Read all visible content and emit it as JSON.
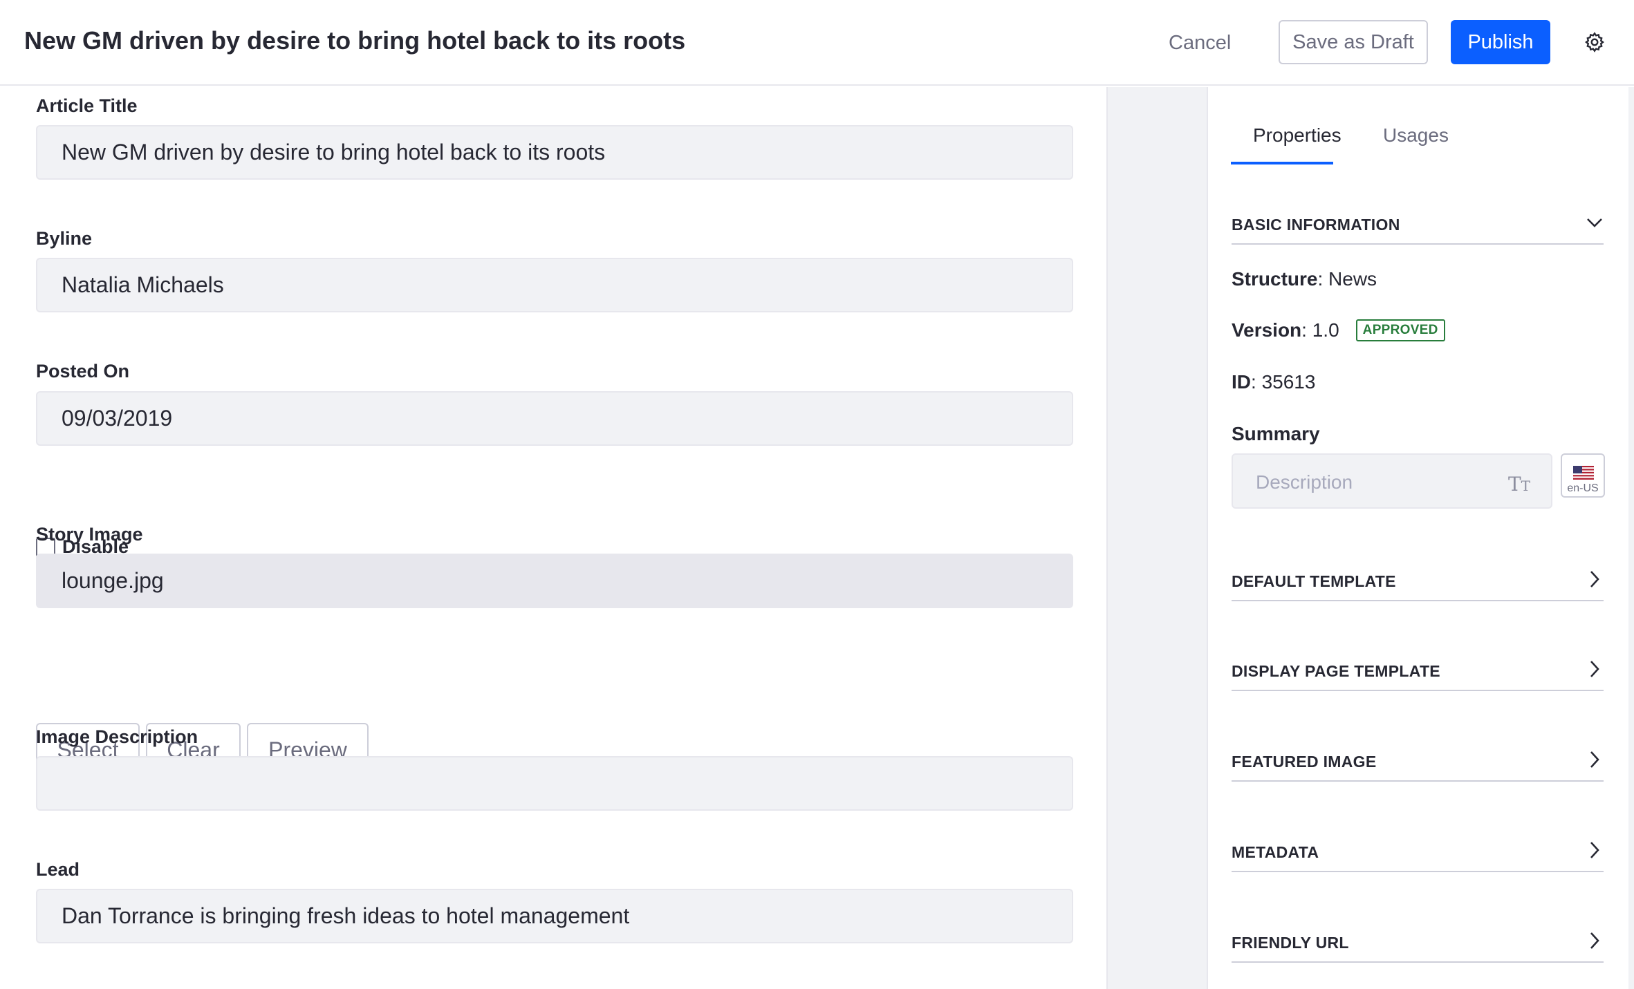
{
  "header": {
    "title": "New GM driven by desire to bring hotel back to its roots",
    "cancel_label": "Cancel",
    "save_draft_label": "Save as Draft",
    "publish_label": "Publish",
    "settings_icon": "gear-icon"
  },
  "form": {
    "article_title": {
      "label": "Article Title",
      "value": "New GM driven by desire to bring hotel back to its roots"
    },
    "byline": {
      "label": "Byline",
      "value": "Natalia Michaels"
    },
    "posted_on": {
      "label": "Posted On",
      "value": "09/03/2019",
      "disable_label": "Disable",
      "disable_checked": false
    },
    "story_image": {
      "label": "Story Image",
      "value": "lounge.jpg",
      "select_label": "Select",
      "clear_label": "Clear",
      "preview_label": "Preview"
    },
    "image_description": {
      "label": "Image Description",
      "value": ""
    },
    "lead": {
      "label": "Lead",
      "value": "Dan Torrance is bringing fresh ideas to hotel management"
    }
  },
  "sidebar": {
    "tabs": [
      {
        "label": "Properties",
        "active": true
      },
      {
        "label": "Usages",
        "active": false
      }
    ],
    "basic_information": {
      "title": "BASIC INFORMATION",
      "structure_label": "Structure",
      "structure_value": "News",
      "version_label": "Version",
      "version_value": "1.0",
      "status_badge": "APPROVED",
      "id_label": "ID",
      "id_value": "35613",
      "summary_label": "Summary",
      "summary_placeholder": "Description",
      "language_code": "en-US"
    },
    "panels": [
      {
        "title": "DEFAULT TEMPLATE"
      },
      {
        "title": "DISPLAY PAGE TEMPLATE"
      },
      {
        "title": "FEATURED IMAGE"
      },
      {
        "title": "METADATA"
      },
      {
        "title": "FRIENDLY URL"
      }
    ]
  },
  "colors": {
    "primary": "#0b5fff",
    "approved": "#287d3c",
    "input_bg": "#f1f2f5"
  }
}
